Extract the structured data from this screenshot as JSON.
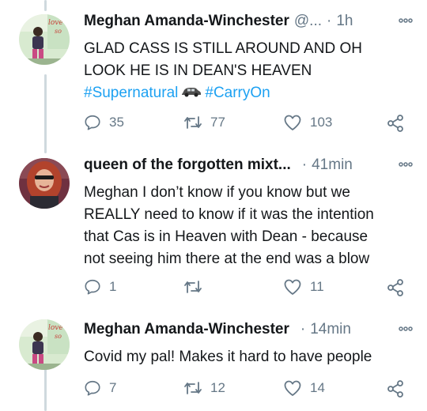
{
  "tweets": [
    {
      "author_name": "Meghan Amanda-Winchester",
      "handle": "@...",
      "separator": "·",
      "time": "1h",
      "more_icon": "more-dots-icon",
      "text_lines": [
        "GLAD CASS IS STILL AROUND AND OH",
        "LOOK HE IS IN DEAN'S HEAVEN"
      ],
      "hashtags": [
        "#Supernatural",
        "#CarryOn"
      ],
      "hashtag_emoji": "car-emoji",
      "replies": "35",
      "retweets": "77",
      "likes": "103"
    },
    {
      "author_name": "queen of the forgotten mixt...",
      "separator": "·",
      "time": "41min",
      "text_lines": [
        "Meghan I don’t know if you know but we",
        "REALLY need to know if it was the intention",
        "that Cas is in Heaven with Dean - because",
        "not seeing him there at the end was a blow"
      ],
      "replies": "1",
      "retweets": "",
      "likes": "11"
    },
    {
      "author_name": "Meghan Amanda-Winchester",
      "separator": "·",
      "time": "14min",
      "text_lines": [
        "Covid my pal! Makes it hard to have people"
      ],
      "replies": "7",
      "retweets": "12",
      "likes": "14"
    }
  ],
  "colors": {
    "accent": "#1da1f2",
    "muted": "#657786",
    "thread_line": "#cfd9de"
  }
}
